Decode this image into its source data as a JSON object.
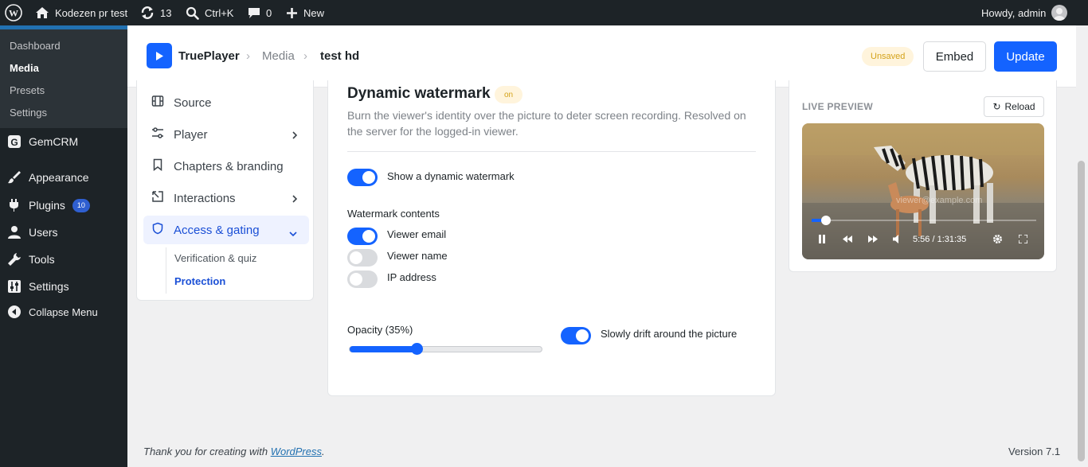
{
  "admin_bar": {
    "site_name": "Kodezen pr test",
    "updates_count": "13",
    "search_shortcut": "Ctrl+K",
    "comments_count": "0",
    "new_label": "New",
    "greeting": "Howdy, admin"
  },
  "sidebar": {
    "submenu": [
      "Dashboard",
      "Media",
      "Presets",
      "Settings"
    ],
    "items": [
      {
        "label": "GemCRM",
        "icon": "gemcrm-icon"
      },
      {
        "label": "Appearance",
        "icon": "paintbrush-icon"
      },
      {
        "label": "Plugins",
        "icon": "plugin-icon",
        "badge": "10"
      },
      {
        "label": "Users",
        "icon": "user-icon"
      },
      {
        "label": "Tools",
        "icon": "wrench-icon"
      },
      {
        "label": "Settings",
        "icon": "sliders-icon"
      },
      {
        "label": "Collapse Menu",
        "icon": "collapse-icon"
      }
    ]
  },
  "header": {
    "brand": "TruePlayer",
    "breadcrumb_media": "Media",
    "breadcrumb_current": "test hd",
    "status_badge": "Unsaved",
    "embed_label": "Embed",
    "update_label": "Update"
  },
  "settings_nav": {
    "items": [
      "Source",
      "Player",
      "Chapters & branding",
      "Interactions",
      "Access & gating"
    ],
    "subitems": [
      "Verification & quiz",
      "Protection"
    ]
  },
  "watermark": {
    "title": "Dynamic watermark",
    "status": "on",
    "description": "Burn the viewer's identity over the picture to deter screen recording. Resolved on the server for the logged-in viewer.",
    "show_label": "Show a dynamic watermark",
    "show_enabled": true,
    "contents_heading": "Watermark contents",
    "contents": [
      {
        "label": "Viewer email",
        "enabled": true
      },
      {
        "label": "Viewer name",
        "enabled": false
      },
      {
        "label": "IP address",
        "enabled": false
      }
    ],
    "opacity_label": "Opacity (35%)",
    "opacity_value": 0.35,
    "drift_label": "Slowly drift around the picture",
    "drift_enabled": true
  },
  "preview": {
    "heading": "LIVE PREVIEW",
    "reload_label": "Reload",
    "watermark_text": "viewer@example.com",
    "time": "5:56 / 1:31:35",
    "progress": 0.065
  },
  "footer": {
    "text_before": "Thank you for creating with ",
    "link": "WordPress",
    "text_after": ".",
    "version": "Version 7.1"
  },
  "colors": {
    "accent": "#1463ff",
    "wp_blue": "#2271b1",
    "admin_bg": "#1d2327",
    "badge_unsaved_bg": "#fff4dc",
    "badge_unsaved_text": "#d4a21a"
  }
}
